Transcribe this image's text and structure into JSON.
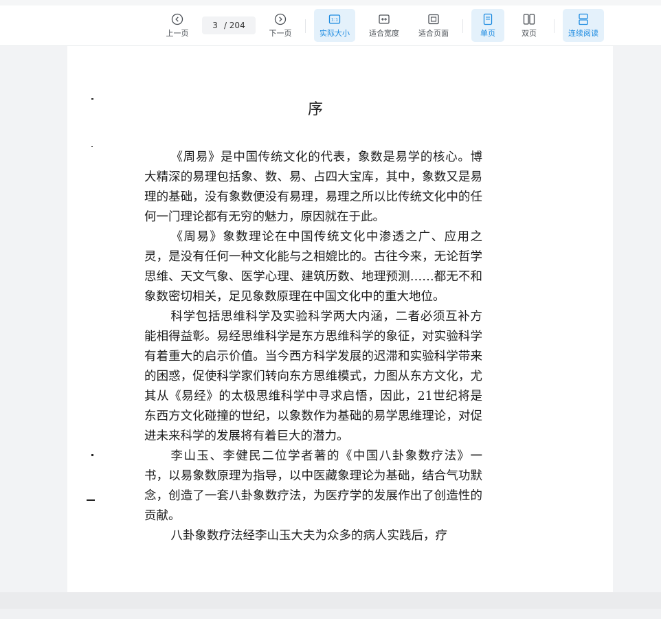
{
  "toolbar": {
    "prev_label": "上一页",
    "next_label": "下一页",
    "current_page": "3",
    "total_pages": "/ 204",
    "actual_size_label": "实际大小",
    "fit_width_label": "适合宽度",
    "fit_page_label": "适合页面",
    "single_page_label": "单页",
    "double_page_label": "双页",
    "continuous_label": "连续阅读",
    "active_zoom": "实际大小",
    "active_layout": "单页",
    "active_scroll": "连续阅读",
    "accent_color": "#1989e0"
  },
  "document": {
    "title": "序",
    "paragraphs": [
      "《周易》是中国传统文化的代表，象数是易学的核心。博大精深的易理包括象、数、易、占四大宝库，其中，象数又是易理的基础，没有象数便没有易理，易理之所以比传统文化中的任何一门理论都有无穷的魅力，原因就在于此。",
      "《周易》象数理论在中国传统文化中渗透之广、应用之灵，是没有任何一种文化能与之相媲比的。古往今来，无论哲学思维、天文气象、医学心理、建筑历数、地理预测……都无不和象数密切相关，足见象数原理在中国文化中的重大地位。",
      "科学包括思维科学及实验科学两大内涵，二者必须互补方能相得益彰。易经思维科学是东方思维科学的象征，对实验科学有着重大的启示价值。当今西方科学发展的迟滞和实验科学带来的困惑，促使科学家们转向东方思维模式，力图从东方文化，尤其从《易经》的太极思维科学中寻求启悟，因此，21世纪将是东西方文化碰撞的世纪，以象数作为基础的易学思维理论，对促进未来科学的发展将有着巨大的潜力。",
      "李山玉、李健民二位学者著的《中国八卦象数疗法》一书，以易象数原理为指导，以中医藏象理论为基础，结合气功默念，创造了一套八卦象数疗法，为医疗学的发展作出了创造性的贡献。",
      "八卦象数疗法经李山玉大夫为众多的病人实践后，疗"
    ]
  }
}
